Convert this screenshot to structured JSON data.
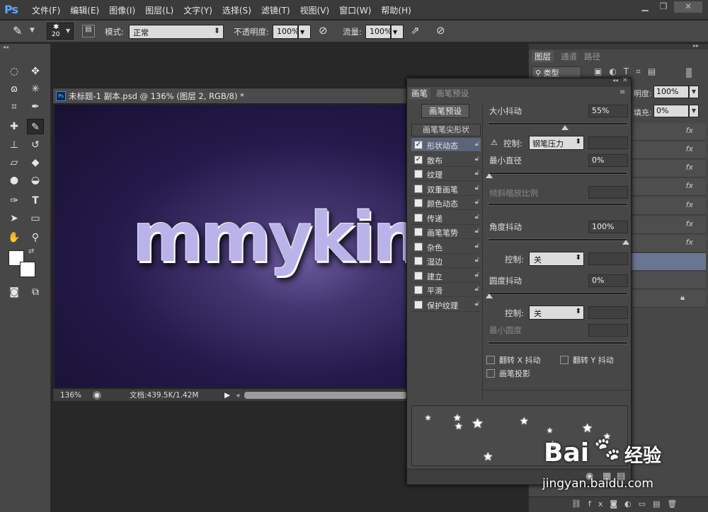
{
  "menubar": {
    "logo": "Ps",
    "items": [
      "文件(F)",
      "编辑(E)",
      "图像(I)",
      "图层(L)",
      "文字(Y)",
      "选择(S)",
      "滤镜(T)",
      "视图(V)",
      "窗口(W)",
      "帮助(H)"
    ]
  },
  "options": {
    "brush_size": "20",
    "mode_label": "模式:",
    "mode_value": "正常",
    "opacity_label": "不透明度:",
    "opacity_value": "100%",
    "flow_label": "流量:",
    "flow_value": "100%"
  },
  "document": {
    "title": "未标题-1 副本.psd @ 136% (图层 2, RGB/8) *",
    "canvas_text": "mmyking",
    "zoom": "136%",
    "file_info": "文档:439.5K/1.42M"
  },
  "layers_panel": {
    "tabs": [
      "图层",
      "通道",
      "路径"
    ],
    "filter_label": "类型",
    "opacity_label": "明度:",
    "opacity_value": "100%",
    "fill_label": "填充:",
    "fill_value": "0%",
    "fx_label": "fx"
  },
  "brush_panel": {
    "tabs": [
      "画笔",
      "画笔预设"
    ],
    "preset_button": "画笔预设",
    "tip_shape_header": "画笔笔尖形状",
    "options": [
      {
        "label": "形状动态",
        "checked": true
      },
      {
        "label": "散布",
        "checked": true
      },
      {
        "label": "纹理",
        "checked": false
      },
      {
        "label": "双重画笔",
        "checked": false
      },
      {
        "label": "颜色动态",
        "checked": false
      },
      {
        "label": "传递",
        "checked": false
      },
      {
        "label": "画笔笔势",
        "checked": false
      },
      {
        "label": "杂色",
        "checked": false
      },
      {
        "label": "湿边",
        "checked": false
      },
      {
        "label": "建立",
        "checked": false
      },
      {
        "label": "平滑",
        "checked": false
      },
      {
        "label": "保护纹理",
        "checked": false
      }
    ],
    "size_jitter_label": "大小抖动",
    "size_jitter_value": "55%",
    "control_label": "控制:",
    "control1_value": "钢笔压力",
    "min_diameter_label": "最小直径",
    "min_diameter_value": "0%",
    "tilt_scale_label": "倾斜缩放比例",
    "angle_jitter_label": "角度抖动",
    "angle_jitter_value": "100%",
    "control2_value": "关",
    "roundness_jitter_label": "圆度抖动",
    "roundness_jitter_value": "0%",
    "control3_value": "关",
    "min_roundness_label": "最小圆度",
    "flip_x_label": "翻转 X 抖动",
    "flip_y_label": "翻转 Y 抖动",
    "brush_projection_label": "画笔投影"
  },
  "watermark": {
    "brand": "Bai",
    "brand2": "经验",
    "url": "jingyan.baidu.com"
  }
}
